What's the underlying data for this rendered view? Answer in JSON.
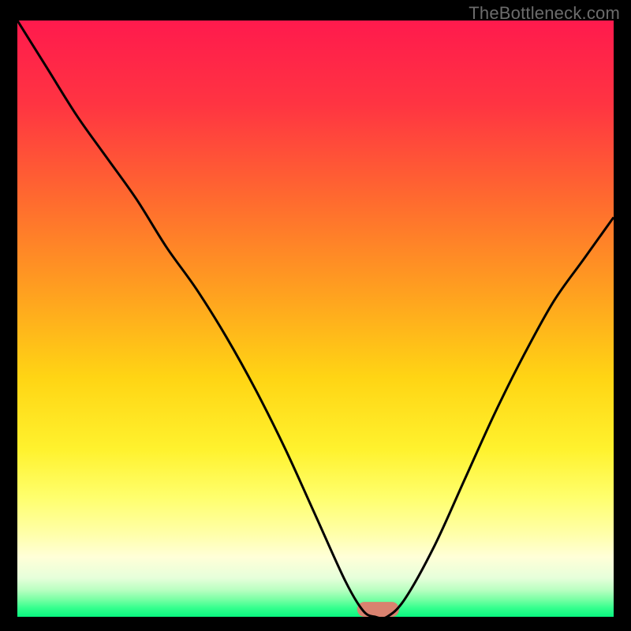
{
  "watermark": "TheBottleneck.com",
  "chart_data": {
    "type": "line",
    "title": "",
    "xlabel": "",
    "ylabel": "",
    "xlim": [
      0,
      100
    ],
    "ylim": [
      0,
      100
    ],
    "grid": false,
    "legend": false,
    "background_gradient_stops": [
      {
        "offset": 0,
        "color": "#ff1a4d"
      },
      {
        "offset": 0.14,
        "color": "#ff3442"
      },
      {
        "offset": 0.3,
        "color": "#ff6a2f"
      },
      {
        "offset": 0.45,
        "color": "#ff9e20"
      },
      {
        "offset": 0.6,
        "color": "#ffd514"
      },
      {
        "offset": 0.72,
        "color": "#fff22e"
      },
      {
        "offset": 0.8,
        "color": "#ffff6d"
      },
      {
        "offset": 0.86,
        "color": "#ffffa8"
      },
      {
        "offset": 0.9,
        "color": "#ffffd8"
      },
      {
        "offset": 0.935,
        "color": "#e6ffda"
      },
      {
        "offset": 0.955,
        "color": "#b9ffc1"
      },
      {
        "offset": 0.97,
        "color": "#7dffa6"
      },
      {
        "offset": 0.985,
        "color": "#35ff8e"
      },
      {
        "offset": 1.0,
        "color": "#08f57f"
      }
    ],
    "series": [
      {
        "name": "curve",
        "color": "#000000",
        "x": [
          0,
          5,
          10,
          15,
          20,
          25,
          30,
          35,
          40,
          45,
          50,
          55,
          58,
          60,
          62,
          65,
          70,
          75,
          80,
          85,
          90,
          95,
          100
        ],
        "y": [
          100,
          92,
          84,
          77,
          70,
          62,
          55,
          47,
          38,
          28,
          17,
          6,
          1,
          0,
          0,
          3,
          12,
          23,
          34,
          44,
          53,
          60,
          67
        ]
      }
    ],
    "marker": {
      "x_center": 60.5,
      "y": 0,
      "width": 7,
      "height": 2.5,
      "color": "#d9816f",
      "radius": 1.2
    }
  }
}
